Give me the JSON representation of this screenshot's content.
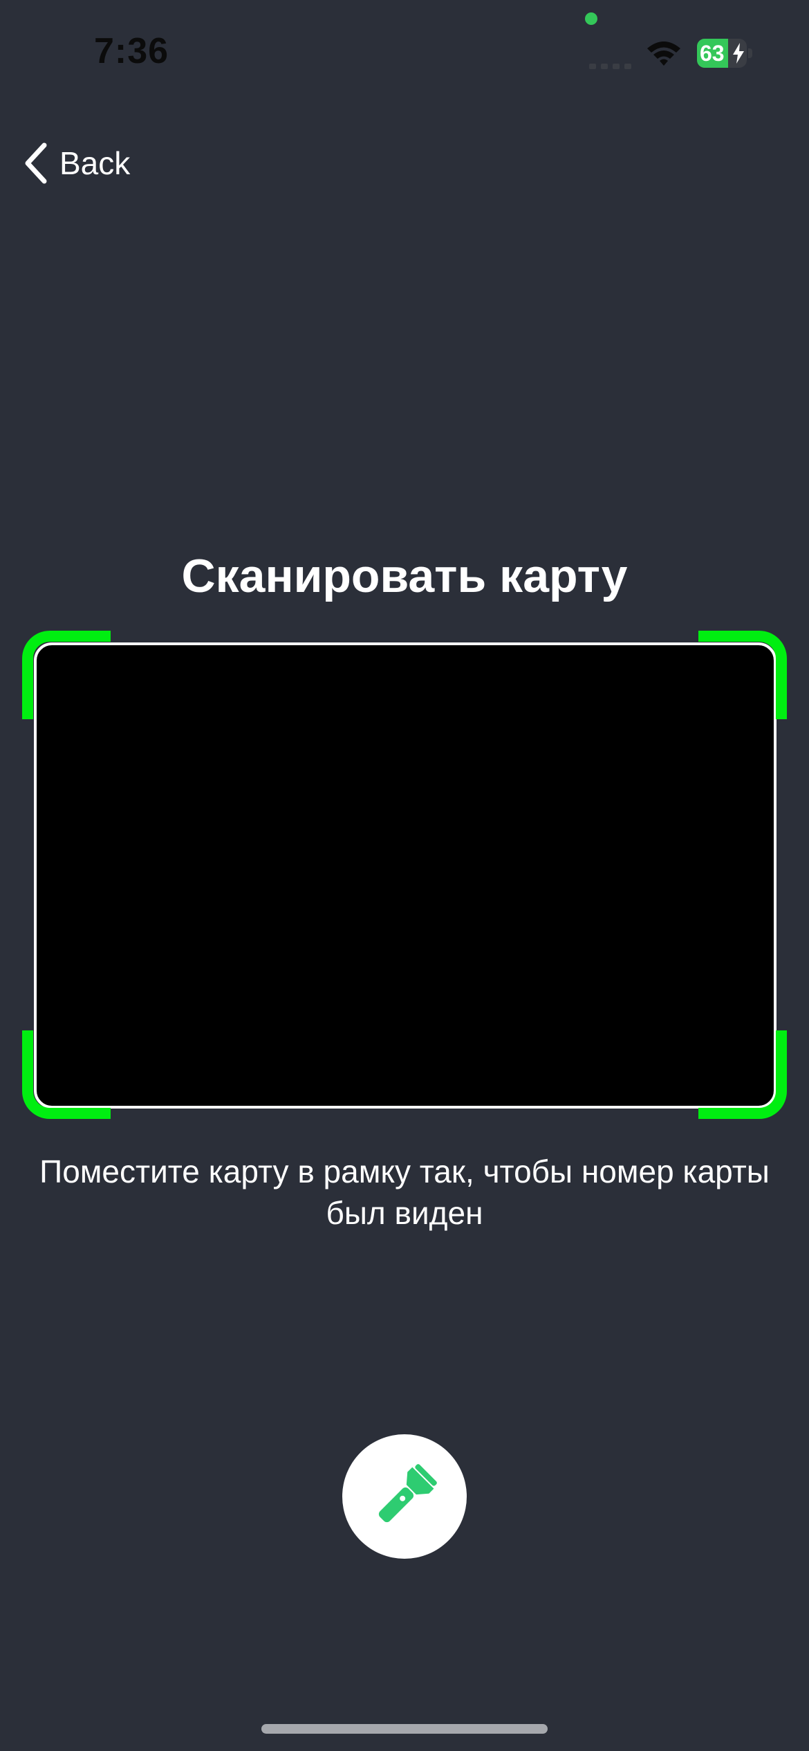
{
  "status_bar": {
    "time": "7:36",
    "battery_level": "63",
    "battery_fraction": 0.63,
    "icons": [
      "privacy-dot",
      "signal-icon",
      "wifi-icon",
      "battery-icon",
      "charging-bolt-icon"
    ]
  },
  "nav": {
    "back_label": "Back",
    "back_icon": "chevron-left-icon"
  },
  "scanner": {
    "title": "Сканировать карту",
    "instruction": "Поместите карту в рамку так, чтобы номер карты был виден",
    "flashlight_icon": "flashlight-icon"
  },
  "colors": {
    "background": "#2b2f39",
    "frame_accent": "#00ee11",
    "flashlight": "#2ecc71",
    "battery_fill": "#34c759"
  }
}
